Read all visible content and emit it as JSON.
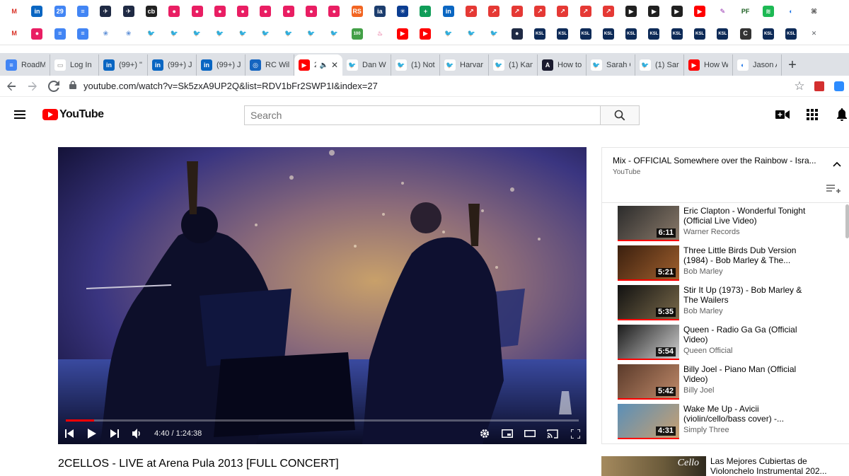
{
  "bookmarks_row1": [
    {
      "icon": "gmail-icon",
      "color": "#ffffff",
      "fg": "#d93025",
      "glyph": "M"
    },
    {
      "icon": "linkedin-icon",
      "color": "#0a66c2",
      "glyph": "in"
    },
    {
      "icon": "calendar-icon",
      "color": "#4285f4",
      "glyph": "29"
    },
    {
      "icon": "docs-icon",
      "color": "#4285f4",
      "glyph": "≡"
    },
    {
      "icon": "plane-icon",
      "color": "#1f2a44",
      "glyph": "✈"
    },
    {
      "icon": "plane-icon",
      "color": "#1f2a44",
      "glyph": "✈"
    },
    {
      "icon": "circle-logo-icon",
      "color": "#222222",
      "glyph": "cb"
    },
    {
      "icon": "podcast-icon",
      "color": "#e91e63",
      "glyph": "●"
    },
    {
      "icon": "podcast-icon",
      "color": "#e91e63",
      "glyph": "●"
    },
    {
      "icon": "podcast-icon",
      "color": "#e91e63",
      "glyph": "●"
    },
    {
      "icon": "podcast-icon",
      "color": "#e91e63",
      "glyph": "●"
    },
    {
      "icon": "podcast-icon",
      "color": "#e91e63",
      "glyph": "●"
    },
    {
      "icon": "podcast-icon",
      "color": "#e91e63",
      "glyph": "●"
    },
    {
      "icon": "podcast-icon",
      "color": "#e91e63",
      "glyph": "●"
    },
    {
      "icon": "podcast-icon",
      "color": "#e91e63",
      "glyph": "●"
    },
    {
      "icon": "rs-icon",
      "color": "#f26522",
      "glyph": "RS"
    },
    {
      "icon": "ia-icon",
      "color": "#1c3d6e",
      "glyph": "ia"
    },
    {
      "icon": "snowflake-icon",
      "color": "#0b3d91",
      "glyph": "✳"
    },
    {
      "icon": "sheets-icon",
      "color": "#0f9d58",
      "glyph": "+"
    },
    {
      "icon": "linkedin-icon",
      "color": "#0a66c2",
      "glyph": "in"
    },
    {
      "icon": "arrow-square-icon",
      "color": "#e53935",
      "glyph": "↗"
    },
    {
      "icon": "arrow-square-icon",
      "color": "#e53935",
      "glyph": "↗"
    },
    {
      "icon": "arrow-square-icon",
      "color": "#e53935",
      "glyph": "↗"
    },
    {
      "icon": "arrow-square-icon",
      "color": "#e53935",
      "glyph": "↗"
    },
    {
      "icon": "arrow-square-icon",
      "color": "#e53935",
      "glyph": "↗"
    },
    {
      "icon": "arrow-square-icon",
      "color": "#e53935",
      "glyph": "↗"
    },
    {
      "icon": "arrow-square-icon",
      "color": "#e53935",
      "glyph": "↗"
    },
    {
      "icon": "pocket-casts-icon",
      "color": "#202020",
      "glyph": "▶"
    },
    {
      "icon": "pocket-casts-icon",
      "color": "#202020",
      "glyph": "▶"
    },
    {
      "icon": "pocket-casts-icon",
      "color": "#202020",
      "glyph": "▶"
    },
    {
      "icon": "youtube-icon",
      "color": "#ff0000",
      "glyph": "▶"
    },
    {
      "icon": "feather-icon",
      "color": "#ffffff",
      "fg": "#8e24aa",
      "glyph": "✎"
    },
    {
      "icon": "pf-icon",
      "color": "#ffffff",
      "fg": "#1b5e20",
      "glyph": "PF"
    },
    {
      "icon": "spotify-icon",
      "color": "#1db954",
      "glyph": "≋"
    },
    {
      "icon": "moon-icon",
      "color": "#ffffff",
      "fg": "#1a73e8",
      "glyph": "◐"
    },
    {
      "icon": "extension-icon",
      "color": "#ffffff",
      "fg": "#333333",
      "glyph": "⌘"
    }
  ],
  "bookmarks_row2": [
    {
      "icon": "gmail-icon",
      "color": "#ffffff",
      "fg": "#d93025",
      "glyph": "M"
    },
    {
      "icon": "podcast-icon",
      "color": "#e91e63",
      "glyph": "●"
    },
    {
      "icon": "docs-icon",
      "color": "#4285f4",
      "glyph": "≡"
    },
    {
      "icon": "docs-icon",
      "color": "#4285f4",
      "glyph": "≡"
    },
    {
      "icon": "tree-icon",
      "color": "#ffffff",
      "fg": "#5c8ed6",
      "glyph": "❀"
    },
    {
      "icon": "tree-icon",
      "color": "#ffffff",
      "fg": "#5c8ed6",
      "glyph": "❀"
    },
    {
      "icon": "twitter-icon",
      "color": "#ffffff",
      "fg": "#1da1f2",
      "glyph": "🐦"
    },
    {
      "icon": "twitter-icon",
      "color": "#ffffff",
      "fg": "#1da1f2",
      "glyph": "🐦"
    },
    {
      "icon": "twitter-icon",
      "color": "#ffffff",
      "fg": "#1da1f2",
      "glyph": "🐦"
    },
    {
      "icon": "twitter-icon",
      "color": "#ffffff",
      "fg": "#1da1f2",
      "glyph": "🐦"
    },
    {
      "icon": "twitter-icon",
      "color": "#ffffff",
      "fg": "#1da1f2",
      "glyph": "🐦"
    },
    {
      "icon": "twitter-icon",
      "color": "#ffffff",
      "fg": "#1da1f2",
      "glyph": "🐦"
    },
    {
      "icon": "twitter-icon",
      "color": "#ffffff",
      "fg": "#1da1f2",
      "glyph": "🐦"
    },
    {
      "icon": "twitter-icon",
      "color": "#ffffff",
      "fg": "#1da1f2",
      "glyph": "🐦"
    },
    {
      "icon": "twitter-icon",
      "color": "#ffffff",
      "fg": "#1da1f2",
      "glyph": "🐦"
    },
    {
      "icon": "badge-100-icon",
      "color": "#43a047",
      "glyph": "100"
    },
    {
      "icon": "chick-icon",
      "color": "#ffffff",
      "fg": "#d81b60",
      "glyph": "♨"
    },
    {
      "icon": "youtube-icon",
      "color": "#ff0000",
      "glyph": "▶"
    },
    {
      "icon": "youtube-icon",
      "color": "#ff0000",
      "glyph": "▶"
    },
    {
      "icon": "twitter-icon",
      "color": "#ffffff",
      "fg": "#1da1f2",
      "glyph": "🐦"
    },
    {
      "icon": "twitter-icon",
      "color": "#ffffff",
      "fg": "#1da1f2",
      "glyph": "🐦"
    },
    {
      "icon": "twitter-icon",
      "color": "#ffffff",
      "fg": "#1da1f2",
      "glyph": "🐦"
    },
    {
      "icon": "dot-pill-icon",
      "color": "#1f2a44",
      "glyph": "●"
    },
    {
      "icon": "ksl-icon",
      "color": "#0d2a57",
      "glyph": "KSL"
    },
    {
      "icon": "ksl-icon",
      "color": "#0d2a57",
      "glyph": "KSL"
    },
    {
      "icon": "ksl-icon",
      "color": "#0d2a57",
      "glyph": "KSL"
    },
    {
      "icon": "ksl-icon",
      "color": "#0d2a57",
      "glyph": "KSL"
    },
    {
      "icon": "ksl-icon",
      "color": "#0d2a57",
      "glyph": "KSL"
    },
    {
      "icon": "ksl-icon",
      "color": "#0d2a57",
      "glyph": "KSL"
    },
    {
      "icon": "ksl-icon",
      "color": "#0d2a57",
      "glyph": "KSL"
    },
    {
      "icon": "ksl-icon",
      "color": "#0d2a57",
      "glyph": "KSL"
    },
    {
      "icon": "ksl-icon",
      "color": "#0d2a57",
      "glyph": "KSL"
    },
    {
      "icon": "square-c-icon",
      "color": "#333333",
      "glyph": "C"
    },
    {
      "icon": "ksl-icon",
      "color": "#0d2a57",
      "glyph": "KSL"
    },
    {
      "icon": "ksl-icon",
      "color": "#0d2a57",
      "glyph": "KSL"
    },
    {
      "icon": "close-icon",
      "color": "#ffffff",
      "fg": "#5f6368",
      "glyph": "✕"
    }
  ],
  "tabs": [
    {
      "name": "tab-roadm",
      "icon": "docs-icon",
      "color": "#4285f4",
      "glyph": "≡",
      "label": "RoadM"
    },
    {
      "name": "tab-log-in",
      "icon": "page-icon",
      "color": "#ffffff",
      "fg": "#888888",
      "glyph": "▭",
      "label": "Log In"
    },
    {
      "name": "tab-linkedin-1",
      "icon": "linkedin-icon",
      "color": "#0a66c2",
      "glyph": "in",
      "label": "(99+) \""
    },
    {
      "name": "tab-linkedin-2",
      "icon": "linkedin-icon",
      "color": "#0a66c2",
      "glyph": "in",
      "label": "(99+) J"
    },
    {
      "name": "tab-linkedin-3",
      "icon": "linkedin-icon",
      "color": "#0a66c2",
      "glyph": "in",
      "label": "(99+) J"
    },
    {
      "name": "tab-rc-will",
      "icon": "rc-icon",
      "color": "#1565c0",
      "glyph": "◎",
      "label": "RC Will"
    },
    {
      "name": "tab-youtube-active",
      "icon": "youtube-icon",
      "color": "#ff0000",
      "glyph": "▶",
      "label": "2"
    },
    {
      "name": "tab-dan",
      "icon": "twitter-icon",
      "color": "#ffffff",
      "fg": "#1da1f2",
      "glyph": "🐦",
      "label": "Dan W"
    },
    {
      "name": "tab-notifications",
      "icon": "twitter-icon",
      "color": "#ffffff",
      "fg": "#1da1f2",
      "glyph": "🐦",
      "label": "(1) Noti"
    },
    {
      "name": "tab-harvard",
      "icon": "twitter-icon",
      "color": "#ffffff",
      "fg": "#1da1f2",
      "glyph": "🐦",
      "label": "Harvar"
    },
    {
      "name": "tab-kam",
      "icon": "twitter-icon",
      "color": "#ffffff",
      "fg": "#1da1f2",
      "glyph": "🐦",
      "label": "(1) Kam"
    },
    {
      "name": "tab-how-to",
      "icon": "arrow-a-icon",
      "color": "#1a1a2e",
      "glyph": "A",
      "label": "How to"
    },
    {
      "name": "tab-sarah-1",
      "icon": "twitter-icon",
      "color": "#ffffff",
      "fg": "#1da1f2",
      "glyph": "🐦",
      "label": "Sarah C"
    },
    {
      "name": "tab-sarah-2",
      "icon": "twitter-icon",
      "color": "#ffffff",
      "fg": "#1da1f2",
      "glyph": "🐦",
      "label": "(1) Sara"
    },
    {
      "name": "tab-how-w",
      "icon": "youtube-icon",
      "color": "#ff0000",
      "glyph": "▶",
      "label": "How W"
    },
    {
      "name": "tab-jason",
      "icon": "moon-icon",
      "color": "#ffffff",
      "fg": "#1a73e8",
      "glyph": "◐",
      "label": "Jason A"
    }
  ],
  "address_bar": {
    "url": "youtube.com/watch?v=Sk5zxA9UP2Q&list=RDV1bFr2SWP1I&index=27"
  },
  "youtube": {
    "logo_text": "YouTube",
    "search_placeholder": "Search",
    "player": {
      "time": "4:40 / 1:24:38",
      "progress": 0.055
    },
    "video_title": "2CELLOS - LIVE at Arena Pula 2013 [FULL CONCERT]",
    "playlist": {
      "title": "Mix - OFFICIAL Somewhere over the Rainbow - Isra...",
      "subtitle": "YouTube",
      "items": [
        {
          "title": "Eric Clapton - Wonderful Tonight (Official Live Video)",
          "channel": "Warner Records",
          "duration": "6:11",
          "thumb": [
            "#2b2b2b",
            "#8a7a6a"
          ]
        },
        {
          "title": "Three Little Birds Dub Version (1984) - Bob Marley & The...",
          "channel": "Bob Marley",
          "duration": "5:21",
          "thumb": [
            "#3a1f0e",
            "#a0602e"
          ]
        },
        {
          "title": "Stir It Up (1973) - Bob Marley & The Wailers",
          "channel": "Bob Marley",
          "duration": "5:35",
          "thumb": [
            "#111111",
            "#7a6a4a"
          ]
        },
        {
          "title": "Queen - Radio Ga Ga (Official Video)",
          "channel": "Queen Official",
          "duration": "5:54",
          "thumb": [
            "#1a1a1a",
            "#d0d0d0"
          ]
        },
        {
          "title": "Billy Joel - Piano Man (Official Video)",
          "channel": "Billy Joel",
          "duration": "5:42",
          "thumb": [
            "#5a3a2a",
            "#c08a6a"
          ]
        },
        {
          "title": "Wake Me Up - Avicii (violin/cello/bass cover) -...",
          "channel": "Simply Three",
          "duration": "4:31",
          "thumb": [
            "#5a8fb8",
            "#c8a070"
          ]
        }
      ]
    },
    "recommended": {
      "brand": "Cello",
      "title": "Las Mejores Cubiertas de Violonchelo Instrumental 202..."
    }
  }
}
